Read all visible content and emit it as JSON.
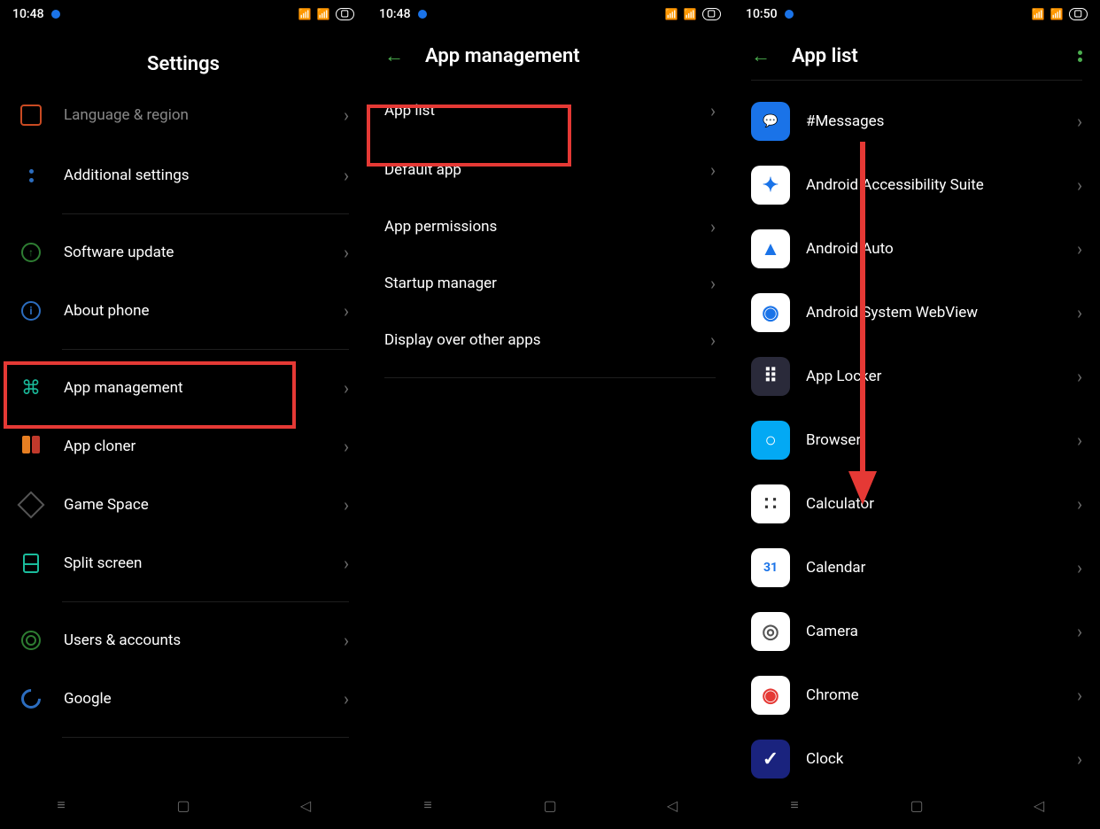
{
  "screens": {
    "settings": {
      "status_time": "10:48",
      "title": "Settings",
      "items": [
        {
          "label": "Language & region",
          "icon": "language-icon"
        },
        {
          "label": "Additional settings",
          "icon": "additional-settings-icon"
        },
        {
          "label": "Software update",
          "icon": "software-update-icon"
        },
        {
          "label": "About phone",
          "icon": "about-phone-icon"
        },
        {
          "label": "App management",
          "icon": "app-management-icon",
          "highlighted": true
        },
        {
          "label": "App cloner",
          "icon": "app-cloner-icon"
        },
        {
          "label": "Game Space",
          "icon": "game-space-icon"
        },
        {
          "label": "Split screen",
          "icon": "split-screen-icon"
        },
        {
          "label": "Users & accounts",
          "icon": "users-accounts-icon"
        },
        {
          "label": "Google",
          "icon": "google-icon"
        }
      ]
    },
    "app_management": {
      "status_time": "10:48",
      "title": "App management",
      "items": [
        {
          "label": "App list",
          "highlighted": true
        },
        {
          "label": "Default app"
        },
        {
          "label": "App permissions"
        },
        {
          "label": "Startup manager"
        },
        {
          "label": "Display over other apps"
        }
      ]
    },
    "app_list": {
      "status_time": "10:50",
      "title": "App list",
      "apps": [
        {
          "name": "#Messages",
          "icon_bg": "#1a73e8",
          "icon_fg": "#fff",
          "glyph": "💬"
        },
        {
          "name": "Android Accessibility Suite",
          "icon_bg": "#fff",
          "icon_fg": "#1a73e8",
          "glyph": "✦"
        },
        {
          "name": "Android Auto",
          "icon_bg": "#fff",
          "icon_fg": "#1a73e8",
          "glyph": "▲"
        },
        {
          "name": "Android System WebView",
          "icon_bg": "#fff",
          "icon_fg": "#1a73e8",
          "glyph": "◉"
        },
        {
          "name": "App Locker",
          "icon_bg": "#2a2a3a",
          "icon_fg": "#fff",
          "glyph": "⠿"
        },
        {
          "name": "Browser",
          "icon_bg": "#03a9f4",
          "icon_fg": "#fff",
          "glyph": "○"
        },
        {
          "name": "Calculator",
          "icon_bg": "#fff",
          "icon_fg": "#333",
          "glyph": "∷"
        },
        {
          "name": "Calendar",
          "icon_bg": "#fff",
          "icon_fg": "#1a73e8",
          "glyph": "31"
        },
        {
          "name": "Camera",
          "icon_bg": "#fff",
          "icon_fg": "#555",
          "glyph": "◎"
        },
        {
          "name": "Chrome",
          "icon_bg": "#fff",
          "icon_fg": "#e53935",
          "glyph": "◉"
        },
        {
          "name": "Clock",
          "icon_bg": "#1a237e",
          "icon_fg": "#fff",
          "glyph": "✓"
        }
      ]
    }
  },
  "status_indicators": {
    "signal": "▮▯▮",
    "wifi": "▮▮",
    "battery_text": "▢"
  }
}
